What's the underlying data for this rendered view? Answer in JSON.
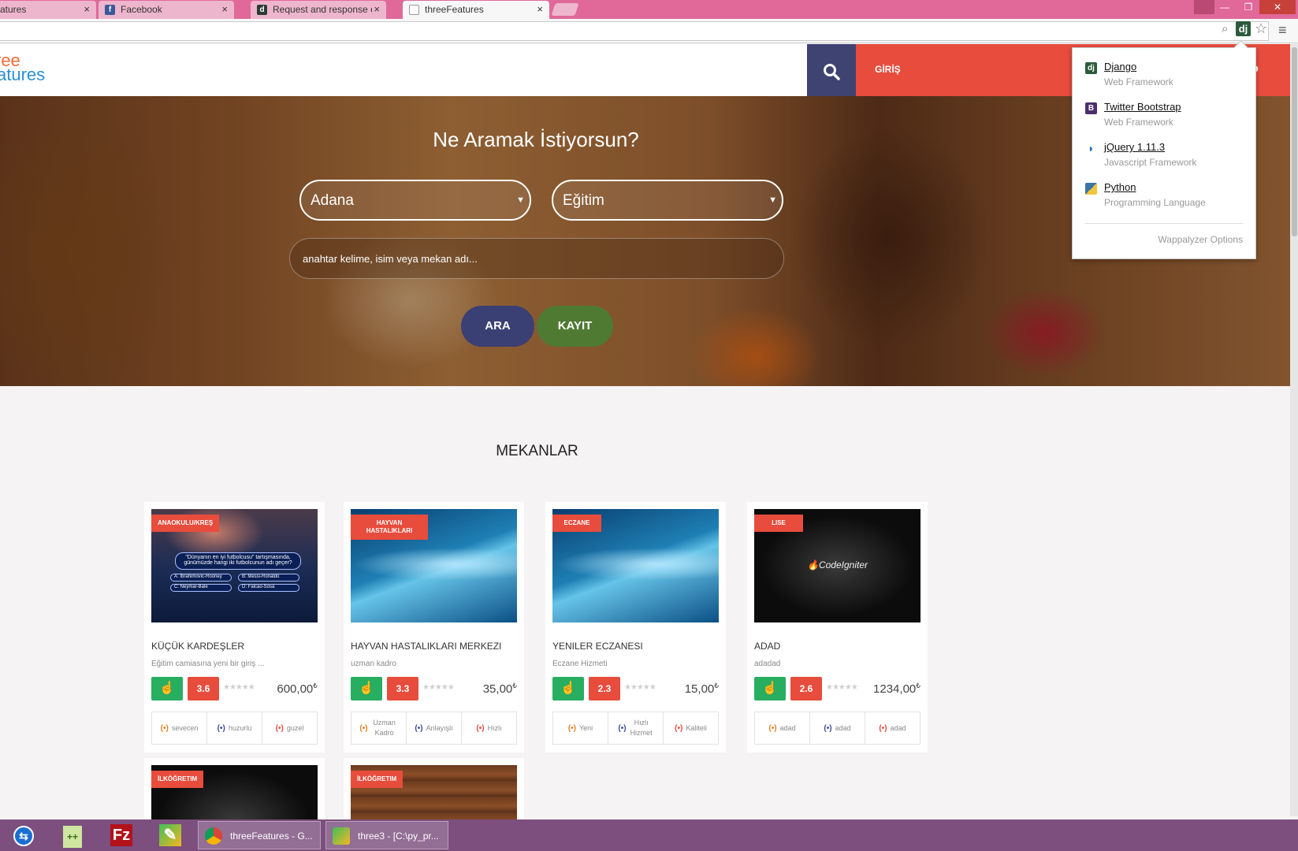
{
  "browser": {
    "tabs": [
      {
        "label": "atures",
        "favicon": "page-icon"
      },
      {
        "label": "Facebook",
        "favicon": "facebook-icon"
      },
      {
        "label": "Request and response obj",
        "favicon": "django-icon"
      },
      {
        "label": "threeFeatures",
        "favicon": "page-icon"
      }
    ],
    "tab_close": "×"
  },
  "site": {
    "logo_line1": "ree",
    "logo_line2": "atures",
    "login_label": "GİRİŞ"
  },
  "hero": {
    "title": "Ne Aramak İstiyorsun?",
    "city_select": "Adana",
    "category_select": "Eğitim",
    "keyword_placeholder": "anahtar kelime, isim veya mekan adı...",
    "search_button": "ARA",
    "register_button": "KAYIT"
  },
  "section": {
    "title": "MEKANLAR"
  },
  "places": [
    {
      "category": "ANAOKULU/KREŞ",
      "image": "quiz-show",
      "quiz_question": "\"Dünyanın en iyi futbolcusu\" tartışmasında, günümüzde hangi iki futbolcunun adı geçer?",
      "quiz_answers": [
        "A: İbrahimovic-Rooney",
        "B: Messi-Ronaldo",
        "C: Neymar-Bale",
        "D: Falcao-Sosa"
      ],
      "title": "KÜÇÜK KARDEŞLER",
      "subtitle": "Eğitim camiasına yeni bir giriş ...",
      "rating": "3.6",
      "price": "600,00",
      "currency": "₺",
      "features": [
        "sevecen",
        "huzurlu",
        "guzel"
      ]
    },
    {
      "category": "HAYVAN HASTALIKLARI",
      "image": "blue-wave",
      "title": "HAYVAN HASTALIKLARI MERKEZI",
      "subtitle": "uzman kadro",
      "rating": "3.3",
      "price": "35,00",
      "currency": "₺",
      "features": [
        "Uzman Kadro",
        "Anlayışlı",
        "Hızlı"
      ]
    },
    {
      "category": "ECZANE",
      "image": "blue-wave",
      "title": "YENILER ECZANESI",
      "subtitle": "Eczane Hizmeti",
      "rating": "2.3",
      "price": "15,00",
      "currency": "₺",
      "features": [
        "Yeni",
        "Hızlı Hizmet",
        "Kaliteli"
      ]
    },
    {
      "category": "LISE",
      "image": "codeigniter",
      "logo_text": "CodeIgniter",
      "title": "ADAD",
      "subtitle": "adadad",
      "rating": "2.6",
      "price": "1234,00",
      "currency": "₺",
      "features": [
        "adad",
        "adad",
        "adad"
      ]
    },
    {
      "category": "İLKÖĞRETIM",
      "image": "dark"
    },
    {
      "category": "İLKÖĞRETIM",
      "image": "wood"
    }
  ],
  "wappalyzer": {
    "items": [
      {
        "name": "Django",
        "category": "Web Framework",
        "icon": "dj",
        "color": "#2b5b3a"
      },
      {
        "name": "Twitter Bootstrap",
        "category": "Web Framework",
        "icon": "B",
        "color": "#4c2f6e"
      },
      {
        "name": "jQuery 1.11.3",
        "category": "Javascript Framework",
        "icon": "~",
        "color": "#1d6fb8"
      },
      {
        "name": "Python",
        "category": "Programming Language",
        "icon": "py",
        "color": "#3a74a8"
      }
    ],
    "options_label": "Wappalyzer Options"
  },
  "taskbar": {
    "tasks": [
      {
        "label": "threeFeatures - G...",
        "icon": "chrome-icon"
      },
      {
        "label": "three3 - [C:\\py_pr...",
        "icon": "pycharm-icon"
      }
    ]
  },
  "colors": {
    "tabstrip": "#e0699a",
    "accent_red": "#e74c3c",
    "accent_navy": "#3f4371",
    "accent_green": "#27ae60",
    "taskbar": "#7c4f7e"
  }
}
